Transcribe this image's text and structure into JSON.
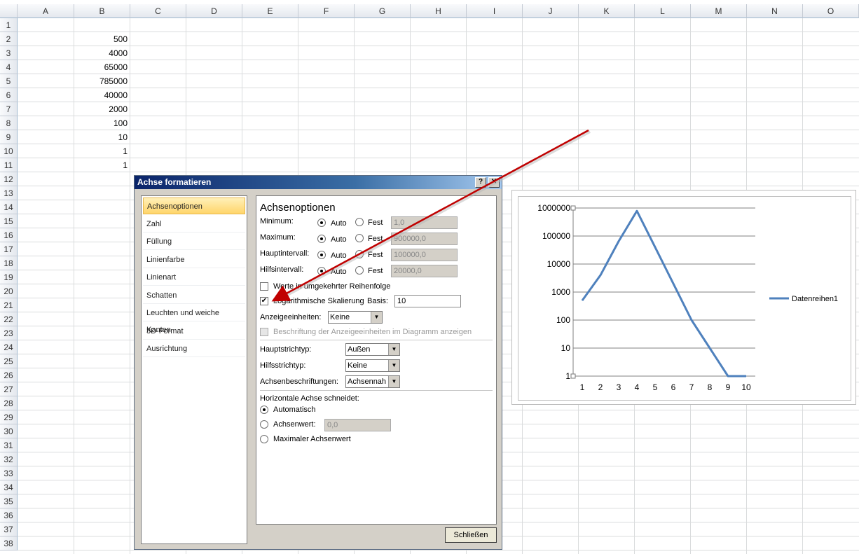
{
  "columns": [
    "A",
    "B",
    "C",
    "D",
    "E",
    "F",
    "G",
    "H",
    "I",
    "J",
    "K",
    "L",
    "M",
    "N",
    "O"
  ],
  "rows": [
    "1",
    "2",
    "3",
    "4",
    "5",
    "6",
    "7",
    "8",
    "9",
    "10",
    "11",
    "12",
    "13",
    "14",
    "15",
    "16",
    "17",
    "18",
    "19",
    "20",
    "21",
    "22",
    "23",
    "24",
    "25",
    "26",
    "27",
    "28",
    "29",
    "30",
    "31",
    "32",
    "33",
    "34",
    "35",
    "36",
    "37",
    "38"
  ],
  "columnB": [
    "",
    "500",
    "4000",
    "65000",
    "785000",
    "40000",
    "2000",
    "100",
    "10",
    "1",
    "1"
  ],
  "dialog": {
    "title": "Achse formatieren",
    "help_glyph": "?",
    "close_glyph": "✕",
    "nav": [
      "Achsenoptionen",
      "Zahl",
      "Füllung",
      "Linienfarbe",
      "Linienart",
      "Schatten",
      "Leuchten und weiche Kanten",
      "3D-Format",
      "Ausrichtung"
    ],
    "heading": "Achsenoptionen",
    "minimum_label": "Minimum:",
    "maximum_label": "Maximum:",
    "major_label": "Hauptintervall:",
    "minor_label": "Hilfsintervall:",
    "auto_label": "Auto",
    "fixed_label": "Fest",
    "minimum_value": "1,0",
    "maximum_value": "900000,0",
    "major_value": "100000,0",
    "minor_value": "20000,0",
    "reverse_label": "Werte in umgekehrter Reihenfolge",
    "log_label": "Logarithmische Skalierung",
    "basis_label": "Basis:",
    "basis_value": "10",
    "display_units_label": "Anzeigeeinheiten:",
    "display_units_value": "Keine",
    "show_units_label": "Beschriftung der Anzeigeeinheiten im Diagramm anzeigen",
    "major_tick_label": "Hauptstrichtyp:",
    "major_tick_value": "Außen",
    "minor_tick_label": "Hilfsstrichtyp:",
    "minor_tick_value": "Keine",
    "axis_labels_label": "Achsenbeschriftungen:",
    "axis_labels_value": "Achsennah",
    "crosses_label": "Horizontale Achse schneidet:",
    "cross_auto": "Automatisch",
    "cross_value_label": "Achsenwert:",
    "cross_value": "0,0",
    "cross_max": "Maximaler Achsenwert",
    "close_button": "Schließen",
    "check_mark": "✔"
  },
  "chart_data": {
    "type": "line",
    "x": [
      1,
      2,
      3,
      4,
      5,
      6,
      7,
      8,
      9,
      10
    ],
    "series": [
      {
        "name": "Datenreihen1",
        "values": [
          500,
          4000,
          65000,
          785000,
          40000,
          2000,
          100,
          10,
          1,
          1
        ]
      }
    ],
    "y_scale": "log",
    "ylim": [
      1,
      1000000
    ],
    "y_ticks": [
      "1",
      "10",
      "100",
      "1000",
      "10000",
      "100000",
      "1000000"
    ],
    "x_ticks": [
      "1",
      "2",
      "3",
      "4",
      "5",
      "6",
      "7",
      "8",
      "9",
      "10"
    ],
    "legend_position": "right",
    "grid": true,
    "color": "#4f81bd"
  },
  "colors": {
    "arrow": "#c00000",
    "accent": "#4f81bd"
  }
}
